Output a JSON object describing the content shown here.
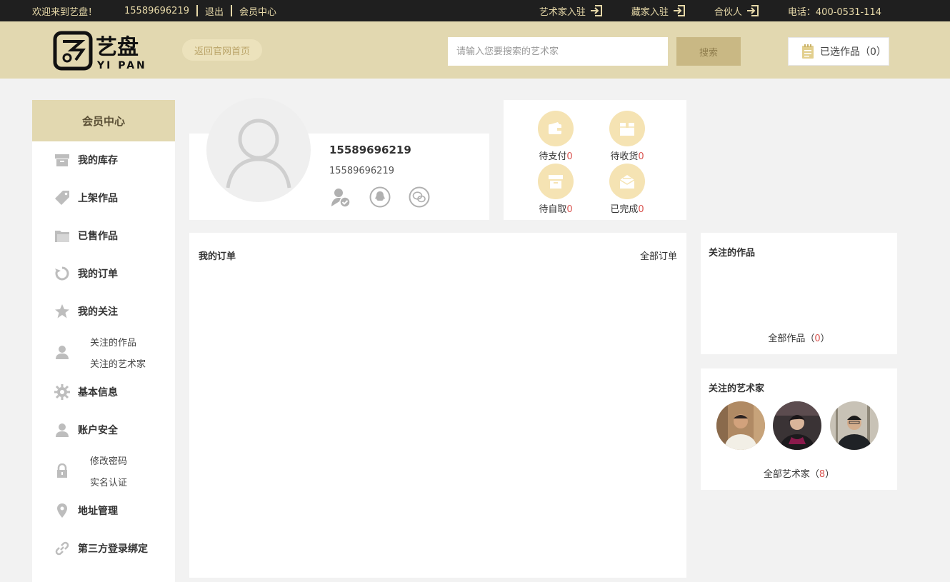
{
  "topbar": {
    "welcome": "欢迎来到艺盘！",
    "phone": "15589696219",
    "logout": "退出",
    "member_center": "会员中心",
    "artist_join": "艺术家入驻",
    "collector_join": "藏家入驻",
    "partner": "合伙人",
    "hotline": "电话：400-0531-114"
  },
  "header": {
    "logo_text": "艺盘",
    "logo_sub": "YI PAN",
    "home_button": "返回官网首页",
    "search_placeholder": "请输入您要搜索的艺术家",
    "search_button": "搜索",
    "cart_label": "已选作品（0）"
  },
  "sidebar": {
    "title": "会员中心",
    "items": [
      {
        "label": "我的库存",
        "icon": "inventory-box-icon"
      },
      {
        "label": "上架作品",
        "icon": "tag-icon"
      },
      {
        "label": "已售作品",
        "icon": "folder-icon"
      },
      {
        "label": "我的订单",
        "icon": "refresh-icon"
      },
      {
        "label": "我的关注",
        "icon": "star-icon"
      },
      {
        "label": "基本信息",
        "icon": "gear-icon"
      },
      {
        "label": "账户安全",
        "icon": "user-icon"
      },
      {
        "label": "地址管理",
        "icon": "location-pin-icon"
      },
      {
        "label": "第三方登录绑定",
        "icon": "link-icon"
      }
    ],
    "follow_sub": [
      "关注的作品",
      "关注的艺术家"
    ],
    "security_sub": [
      "修改密码",
      "实名认证"
    ]
  },
  "profile": {
    "name": "15589696219",
    "phone": "15589696219"
  },
  "order_status": [
    {
      "label": "待支付",
      "count": "0"
    },
    {
      "label": "待收货",
      "count": "0"
    },
    {
      "label": "待自取",
      "count": "0"
    },
    {
      "label": "已完成",
      "count": "0"
    }
  ],
  "orders": {
    "title": "我的订单",
    "all_link": "全部订单"
  },
  "followed_works": {
    "title": "关注的作品",
    "more_label": "全部作品（",
    "count": "0",
    "more_suffix": "）"
  },
  "followed_artists": {
    "title": "关注的艺术家",
    "more_label": "全部艺术家（",
    "count": "8",
    "more_suffix": "）"
  },
  "colors": {
    "accent": "#e2d8b0",
    "topbar": "#1f1f1f",
    "topbar_text": "#e6d8a8",
    "count_red": "#d9534f"
  }
}
